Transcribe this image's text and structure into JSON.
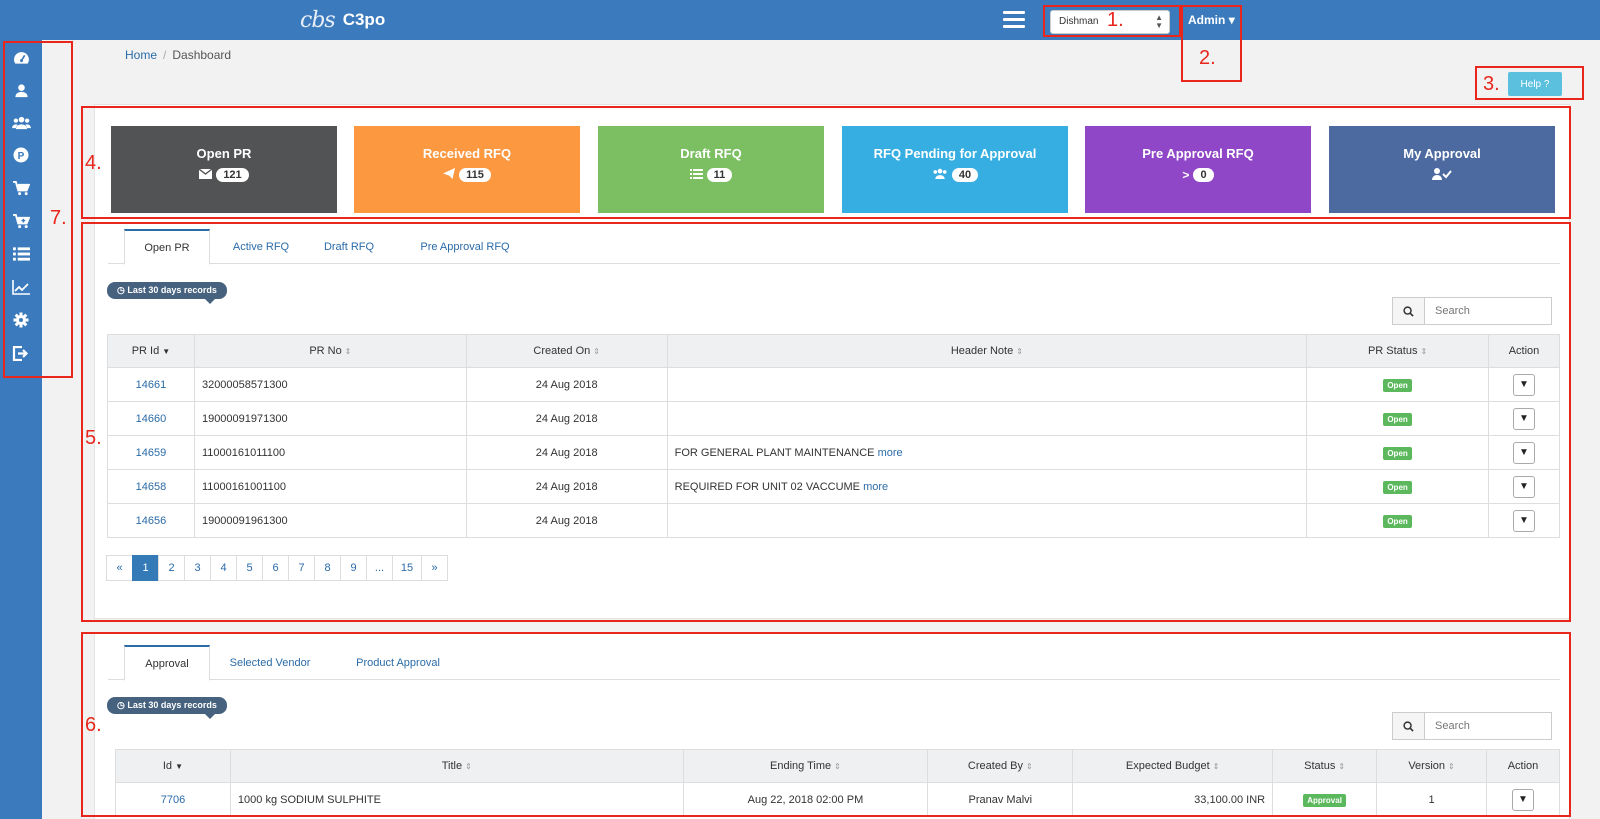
{
  "topbar": {
    "logo_mark": "cbs",
    "app_name": "C3po",
    "company_select": "Dishman",
    "user_menu": "Admin"
  },
  "annotations": [
    "1.",
    "2.",
    "3.",
    "4.",
    "5.",
    "6.",
    "7."
  ],
  "sidebar": {
    "items": [
      {
        "icon": "dashboard-icon"
      },
      {
        "icon": "user-icon"
      },
      {
        "icon": "users-icon"
      },
      {
        "icon": "product-icon"
      },
      {
        "icon": "cart-icon"
      },
      {
        "icon": "cart-add-icon"
      },
      {
        "icon": "list-icon"
      },
      {
        "icon": "chart-icon"
      },
      {
        "icon": "gear-icon"
      },
      {
        "icon": "logout-icon"
      }
    ]
  },
  "breadcrumb": {
    "home": "Home",
    "separator": "/",
    "current": "Dashboard"
  },
  "help": {
    "label": "Help"
  },
  "tiles": [
    {
      "title": "Open PR",
      "icon": "envelope-icon",
      "count": "121",
      "color": "#515354"
    },
    {
      "title": "Received RFQ",
      "icon": "send-icon",
      "count": "115",
      "color": "#fc9840"
    },
    {
      "title": "Draft RFQ",
      "icon": "list-icon",
      "count": "11",
      "color": "#7bbf62"
    },
    {
      "title": "RFQ Pending for Approval",
      "icon": "users-icon",
      "count": "40",
      "color": "#36aee2"
    },
    {
      "title": "Pre Approval RFQ",
      "icon": "chevron-right-icon",
      "count": "0",
      "color": "#8f47c7"
    },
    {
      "title": "My Approval",
      "icon": "user-check-icon",
      "count": "",
      "color": "#4c6aa0"
    }
  ],
  "pr_section": {
    "tabs": [
      "Open PR",
      "Active RFQ",
      "Draft RFQ",
      "Pre Approval RFQ"
    ],
    "records_tag": "Last 30 days records",
    "search_placeholder": "Search",
    "columns": [
      "PR Id",
      "PR No",
      "Created On",
      "Header Note",
      "PR Status",
      "Action"
    ],
    "rows": [
      {
        "id": "14661",
        "no": "32000058571300",
        "created": "24 Aug 2018",
        "note": "",
        "more": "",
        "status": "Open"
      },
      {
        "id": "14660",
        "no": "19000091971300",
        "created": "24 Aug 2018",
        "note": "",
        "more": "",
        "status": "Open"
      },
      {
        "id": "14659",
        "no": "11000161011100",
        "created": "24 Aug 2018",
        "note": "FOR GENERAL PLANT MAINTENANCE",
        "more": "more",
        "status": "Open"
      },
      {
        "id": "14658",
        "no": "11000161001100",
        "created": "24 Aug 2018",
        "note": "REQUIRED FOR UNIT 02 VACCUME",
        "more": "more",
        "status": "Open"
      },
      {
        "id": "14656",
        "no": "19000091961300",
        "created": "24 Aug 2018",
        "note": "",
        "more": "",
        "status": "Open"
      }
    ],
    "pagination": [
      "«",
      "1",
      "2",
      "3",
      "4",
      "5",
      "6",
      "7",
      "8",
      "9",
      "...",
      "15",
      "»"
    ],
    "current_page": "1"
  },
  "approval_section": {
    "tabs": [
      "Approval",
      "Selected Vendor",
      "Product Approval"
    ],
    "records_tag": "Last 30 days records",
    "search_placeholder": "Search",
    "columns": [
      "Id",
      "Title",
      "Ending Time",
      "Created By",
      "Expected Budget",
      "Status",
      "Version",
      "Action"
    ],
    "rows": [
      {
        "id": "7706",
        "title": "1000 kg SODIUM SULPHITE",
        "ending": "Aug 22, 2018 02:00 PM",
        "created_by": "Pranav Malvi",
        "budget": "33,100.00 INR",
        "status": "Approval",
        "version": "1"
      }
    ]
  }
}
